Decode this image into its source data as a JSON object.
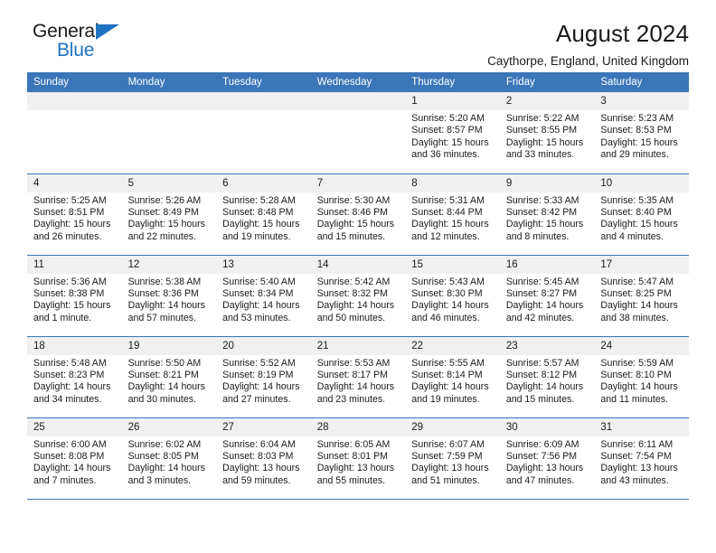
{
  "brand": {
    "name_part1": "General",
    "name_part2": "Blue",
    "accent_color": "#1f72c0"
  },
  "header": {
    "title": "August 2024",
    "subtitle": "Caythorpe, England, United Kingdom",
    "header_bg_color": "#3a76b8",
    "daynum_bg_color": "#f0f0f0"
  },
  "weekdays": [
    "Sunday",
    "Monday",
    "Tuesday",
    "Wednesday",
    "Thursday",
    "Friday",
    "Saturday"
  ],
  "weeks": [
    [
      {
        "day": "",
        "sunrise": "",
        "sunset": "",
        "daylight1": "",
        "daylight2": ""
      },
      {
        "day": "",
        "sunrise": "",
        "sunset": "",
        "daylight1": "",
        "daylight2": ""
      },
      {
        "day": "",
        "sunrise": "",
        "sunset": "",
        "daylight1": "",
        "daylight2": ""
      },
      {
        "day": "",
        "sunrise": "",
        "sunset": "",
        "daylight1": "",
        "daylight2": ""
      },
      {
        "day": "1",
        "sunrise": "Sunrise: 5:20 AM",
        "sunset": "Sunset: 8:57 PM",
        "daylight1": "Daylight: 15 hours",
        "daylight2": "and 36 minutes."
      },
      {
        "day": "2",
        "sunrise": "Sunrise: 5:22 AM",
        "sunset": "Sunset: 8:55 PM",
        "daylight1": "Daylight: 15 hours",
        "daylight2": "and 33 minutes."
      },
      {
        "day": "3",
        "sunrise": "Sunrise: 5:23 AM",
        "sunset": "Sunset: 8:53 PM",
        "daylight1": "Daylight: 15 hours",
        "daylight2": "and 29 minutes."
      }
    ],
    [
      {
        "day": "4",
        "sunrise": "Sunrise: 5:25 AM",
        "sunset": "Sunset: 8:51 PM",
        "daylight1": "Daylight: 15 hours",
        "daylight2": "and 26 minutes."
      },
      {
        "day": "5",
        "sunrise": "Sunrise: 5:26 AM",
        "sunset": "Sunset: 8:49 PM",
        "daylight1": "Daylight: 15 hours",
        "daylight2": "and 22 minutes."
      },
      {
        "day": "6",
        "sunrise": "Sunrise: 5:28 AM",
        "sunset": "Sunset: 8:48 PM",
        "daylight1": "Daylight: 15 hours",
        "daylight2": "and 19 minutes."
      },
      {
        "day": "7",
        "sunrise": "Sunrise: 5:30 AM",
        "sunset": "Sunset: 8:46 PM",
        "daylight1": "Daylight: 15 hours",
        "daylight2": "and 15 minutes."
      },
      {
        "day": "8",
        "sunrise": "Sunrise: 5:31 AM",
        "sunset": "Sunset: 8:44 PM",
        "daylight1": "Daylight: 15 hours",
        "daylight2": "and 12 minutes."
      },
      {
        "day": "9",
        "sunrise": "Sunrise: 5:33 AM",
        "sunset": "Sunset: 8:42 PM",
        "daylight1": "Daylight: 15 hours",
        "daylight2": "and 8 minutes."
      },
      {
        "day": "10",
        "sunrise": "Sunrise: 5:35 AM",
        "sunset": "Sunset: 8:40 PM",
        "daylight1": "Daylight: 15 hours",
        "daylight2": "and 4 minutes."
      }
    ],
    [
      {
        "day": "11",
        "sunrise": "Sunrise: 5:36 AM",
        "sunset": "Sunset: 8:38 PM",
        "daylight1": "Daylight: 15 hours",
        "daylight2": "and 1 minute."
      },
      {
        "day": "12",
        "sunrise": "Sunrise: 5:38 AM",
        "sunset": "Sunset: 8:36 PM",
        "daylight1": "Daylight: 14 hours",
        "daylight2": "and 57 minutes."
      },
      {
        "day": "13",
        "sunrise": "Sunrise: 5:40 AM",
        "sunset": "Sunset: 8:34 PM",
        "daylight1": "Daylight: 14 hours",
        "daylight2": "and 53 minutes."
      },
      {
        "day": "14",
        "sunrise": "Sunrise: 5:42 AM",
        "sunset": "Sunset: 8:32 PM",
        "daylight1": "Daylight: 14 hours",
        "daylight2": "and 50 minutes."
      },
      {
        "day": "15",
        "sunrise": "Sunrise: 5:43 AM",
        "sunset": "Sunset: 8:30 PM",
        "daylight1": "Daylight: 14 hours",
        "daylight2": "and 46 minutes."
      },
      {
        "day": "16",
        "sunrise": "Sunrise: 5:45 AM",
        "sunset": "Sunset: 8:27 PM",
        "daylight1": "Daylight: 14 hours",
        "daylight2": "and 42 minutes."
      },
      {
        "day": "17",
        "sunrise": "Sunrise: 5:47 AM",
        "sunset": "Sunset: 8:25 PM",
        "daylight1": "Daylight: 14 hours",
        "daylight2": "and 38 minutes."
      }
    ],
    [
      {
        "day": "18",
        "sunrise": "Sunrise: 5:48 AM",
        "sunset": "Sunset: 8:23 PM",
        "daylight1": "Daylight: 14 hours",
        "daylight2": "and 34 minutes."
      },
      {
        "day": "19",
        "sunrise": "Sunrise: 5:50 AM",
        "sunset": "Sunset: 8:21 PM",
        "daylight1": "Daylight: 14 hours",
        "daylight2": "and 30 minutes."
      },
      {
        "day": "20",
        "sunrise": "Sunrise: 5:52 AM",
        "sunset": "Sunset: 8:19 PM",
        "daylight1": "Daylight: 14 hours",
        "daylight2": "and 27 minutes."
      },
      {
        "day": "21",
        "sunrise": "Sunrise: 5:53 AM",
        "sunset": "Sunset: 8:17 PM",
        "daylight1": "Daylight: 14 hours",
        "daylight2": "and 23 minutes."
      },
      {
        "day": "22",
        "sunrise": "Sunrise: 5:55 AM",
        "sunset": "Sunset: 8:14 PM",
        "daylight1": "Daylight: 14 hours",
        "daylight2": "and 19 minutes."
      },
      {
        "day": "23",
        "sunrise": "Sunrise: 5:57 AM",
        "sunset": "Sunset: 8:12 PM",
        "daylight1": "Daylight: 14 hours",
        "daylight2": "and 15 minutes."
      },
      {
        "day": "24",
        "sunrise": "Sunrise: 5:59 AM",
        "sunset": "Sunset: 8:10 PM",
        "daylight1": "Daylight: 14 hours",
        "daylight2": "and 11 minutes."
      }
    ],
    [
      {
        "day": "25",
        "sunrise": "Sunrise: 6:00 AM",
        "sunset": "Sunset: 8:08 PM",
        "daylight1": "Daylight: 14 hours",
        "daylight2": "and 7 minutes."
      },
      {
        "day": "26",
        "sunrise": "Sunrise: 6:02 AM",
        "sunset": "Sunset: 8:05 PM",
        "daylight1": "Daylight: 14 hours",
        "daylight2": "and 3 minutes."
      },
      {
        "day": "27",
        "sunrise": "Sunrise: 6:04 AM",
        "sunset": "Sunset: 8:03 PM",
        "daylight1": "Daylight: 13 hours",
        "daylight2": "and 59 minutes."
      },
      {
        "day": "28",
        "sunrise": "Sunrise: 6:05 AM",
        "sunset": "Sunset: 8:01 PM",
        "daylight1": "Daylight: 13 hours",
        "daylight2": "and 55 minutes."
      },
      {
        "day": "29",
        "sunrise": "Sunrise: 6:07 AM",
        "sunset": "Sunset: 7:59 PM",
        "daylight1": "Daylight: 13 hours",
        "daylight2": "and 51 minutes."
      },
      {
        "day": "30",
        "sunrise": "Sunrise: 6:09 AM",
        "sunset": "Sunset: 7:56 PM",
        "daylight1": "Daylight: 13 hours",
        "daylight2": "and 47 minutes."
      },
      {
        "day": "31",
        "sunrise": "Sunrise: 6:11 AM",
        "sunset": "Sunset: 7:54 PM",
        "daylight1": "Daylight: 13 hours",
        "daylight2": "and 43 minutes."
      }
    ]
  ]
}
